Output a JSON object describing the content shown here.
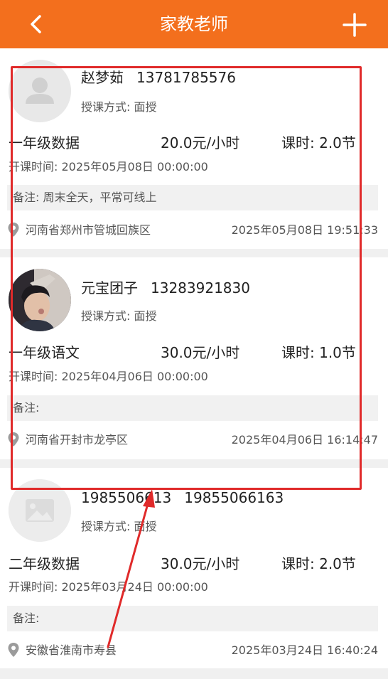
{
  "topbar": {
    "title": "家教老师",
    "back_icon": "chevron-left-icon",
    "add_icon": "plus-icon"
  },
  "colors": {
    "brand": "#f36f1d",
    "highlight": "#e02a2a"
  },
  "teachers": [
    {
      "name": "赵梦茹",
      "phone": "13781785576",
      "mode": "授课方式: 面授",
      "course": "一年级数据",
      "price": "20.0元/小时",
      "hours": "课时: 2.0节",
      "start": "开课时间: 2025年05月08日 00:00:00",
      "note": "备注: 周末全天，平常可线上",
      "address": "河南省郑州市管城回族区",
      "time": "2025年05月08日 19:51:33",
      "avatar": "default-person-avatar"
    },
    {
      "name": "元宝团子",
      "phone": "13283921830",
      "mode": "授课方式: 面授",
      "course": "一年级语文",
      "price": "30.0元/小时",
      "hours": "课时: 1.0节",
      "start": "开课时间: 2025年04月06日 00:00:00",
      "note": "备注:",
      "address": "河南省开封市龙亭区",
      "time": "2025年04月06日 16:14:47",
      "avatar": "photo-avatar"
    },
    {
      "name": "1985506613",
      "phone": "19855066163",
      "mode": "授课方式: 面授",
      "course": "二年级数据",
      "price": "30.0元/小时",
      "hours": "课时: 2.0节",
      "start": "开课时间: 2025年03月24日 00:00:00",
      "note": "备注:",
      "address": "安徽省淮南市寿县",
      "time": "2025年03月24日 16:40:24",
      "avatar": "image-placeholder-avatar"
    }
  ]
}
